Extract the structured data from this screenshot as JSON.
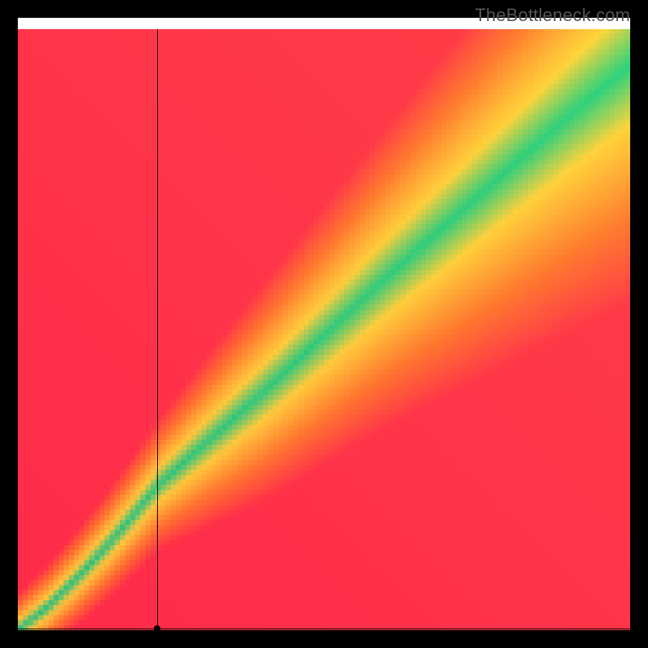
{
  "watermark": "TheBottleneck.com",
  "crosshair": {
    "x_frac": 0.228,
    "y_frac": 0.997
  },
  "heatmap": {
    "grid": 120,
    "colors": {
      "red": "#ff2b4a",
      "orange": "#ff7a2b",
      "yellow": "#ffe33a",
      "green": "#00e08a"
    },
    "thresholds": {
      "green": 0.028,
      "yellow": 0.085
    },
    "mix_exp": 1.15,
    "ridge_comment": "Diagonal green band from lower-left to upper-right with slight S-curve kink near origin; band thickness widens toward top-right."
  },
  "chart_data": {
    "type": "heatmap",
    "title": "",
    "xlabel": "",
    "ylabel": "",
    "xlim": [
      0,
      1
    ],
    "ylim": [
      0,
      1
    ],
    "legend": false,
    "description": "Continuous 2D gradient heatmap. A green ridge runs along a near-diagonal curve y≈f(x) from origin to top-right, flanked by yellow then orange then red as distance from the ridge increases. A black crosshair marks a point near the bottom edge at roughly x=0.23.",
    "ridge_samples_xy": [
      [
        0.0,
        0.0
      ],
      [
        0.05,
        0.04
      ],
      [
        0.1,
        0.09
      ],
      [
        0.15,
        0.145
      ],
      [
        0.2,
        0.205
      ],
      [
        0.228,
        0.24
      ],
      [
        0.3,
        0.305
      ],
      [
        0.4,
        0.395
      ],
      [
        0.5,
        0.49
      ],
      [
        0.6,
        0.585
      ],
      [
        0.7,
        0.675
      ],
      [
        0.8,
        0.765
      ],
      [
        0.9,
        0.855
      ],
      [
        1.0,
        0.94
      ]
    ],
    "band_halfwidth_samples_x_w": [
      [
        0.0,
        0.015
      ],
      [
        0.1,
        0.02
      ],
      [
        0.228,
        0.027
      ],
      [
        0.4,
        0.045
      ],
      [
        0.6,
        0.062
      ],
      [
        0.8,
        0.08
      ],
      [
        1.0,
        0.098
      ]
    ],
    "crosshair_point": {
      "x": 0.228,
      "y": 0.003
    }
  }
}
